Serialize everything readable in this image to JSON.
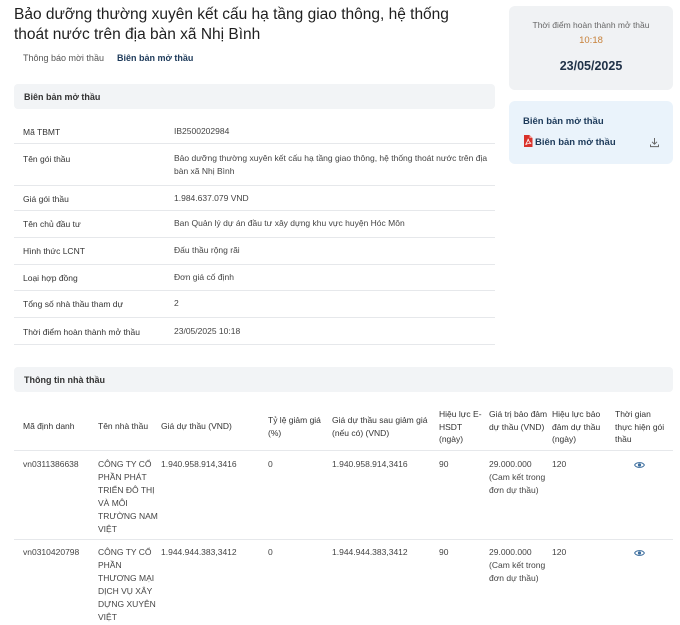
{
  "page": {
    "title": "Bảo dưỡng thường xuyên kết cấu hạ tầng giao thông, hệ thống thoát nước trên địa bàn xã Nhị Bình"
  },
  "tabs": [
    "Thông báo mời thầu",
    "Biên bản mở thầu"
  ],
  "sidebar": {
    "completion_label": "Thời điểm hoàn thành mở thầu",
    "completion_time": "10:18",
    "completion_date": "23/05/2025",
    "doc_section_title": "Biên bản mở thầu",
    "doc_link_label": "Biên bản mở thầu"
  },
  "info": {
    "header": "Biên bản mở thầu",
    "rows": [
      {
        "label": "Mã TBMT",
        "value": "IB2500202984"
      },
      {
        "label": "Tên gói thầu",
        "value": "Bảo dưỡng thường xuyên kết cấu hạ tầng giao thông, hệ thống thoát nước trên địa bàn xã Nhị Bình"
      },
      {
        "label": "Giá gói thầu",
        "value": "1.984.637.079 VND"
      },
      {
        "label": "Tên chủ đầu tư",
        "value": "Ban Quản lý dự án đầu tư xây dựng khu vực huyện Hóc Môn"
      },
      {
        "label": "Hình thức LCNT",
        "value": "Đấu thầu rộng rãi"
      },
      {
        "label": "Loại hợp đồng",
        "value": "Đơn giá cố định"
      },
      {
        "label": "Tổng số nhà thầu tham dự",
        "value": "2"
      },
      {
        "label": "Thời điểm hoàn thành mở thầu",
        "value": "23/05/2025 10:18"
      }
    ]
  },
  "contractors": {
    "header": "Thông tin nhà thầu",
    "columns": [
      "Mã định danh",
      "Tên nhà thầu",
      "Giá dự thầu (VND)",
      "Tỷ lệ giảm giá (%)",
      "Giá dự thầu sau giảm giá (nếu có) (VND)",
      "Hiệu lực E-HSDT (ngày)",
      "Giá trị bảo đảm dự thầu (VND)",
      "Hiệu lực bảo đảm dự thầu (ngày)",
      "Thời gian thực hiện gói thầu"
    ],
    "rows": [
      {
        "id": "vn0311386638",
        "name": "CÔNG TY CỔ PHẦN PHÁT TRIỂN ĐÔ THỊ VÀ MÔI TRƯỜNG NAM VIỆT",
        "bid": "1.940.958.914,3416",
        "discount": "0",
        "bid_after": "1.940.958.914,3416",
        "validity": "90",
        "guarantee": "29.000.000",
        "guarantee_note": "(Cam kết trong đơn dự thầu)",
        "guarantee_validity": "120",
        "duration_icon": "eye-icon"
      },
      {
        "id": "vn0310420798",
        "name": "CÔNG TY CỔ PHẦN THƯƠNG MẠI DỊCH VỤ XÂY DỰNG XUYÊN VIỆT",
        "bid": "1.944.944.383,3412",
        "discount": "0",
        "bid_after": "1.944.944.383,3412",
        "validity": "90",
        "guarantee": "29.000.000",
        "guarantee_note": "(Cam kết trong đơn dự thầu)",
        "guarantee_validity": "120",
        "duration_icon": "eye-icon"
      }
    ]
  },
  "colors": {
    "accent_dark": "#1d3a5a",
    "time_orange": "#c7813a",
    "pdf_red": "#d9322b",
    "eye_blue": "#3c6e9e",
    "header_bg": "#f2f4f6",
    "doc_box_bg": "#eaf3fb"
  }
}
